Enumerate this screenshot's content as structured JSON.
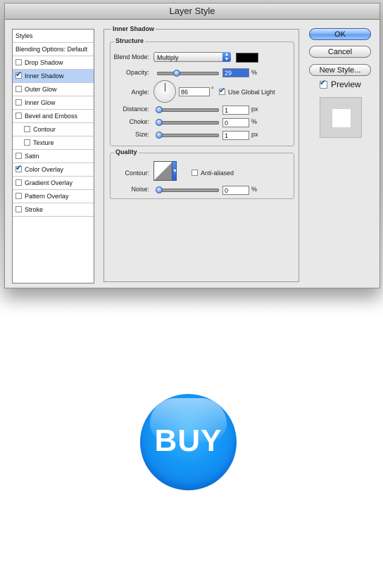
{
  "window": {
    "title": "Layer Style"
  },
  "styles_list": {
    "items": [
      {
        "label": "Styles",
        "checkbox": false
      },
      {
        "label": "Blending Options: Default",
        "checkbox": false
      },
      {
        "label": "Drop Shadow",
        "checkbox": true,
        "checked": false
      },
      {
        "label": "Inner Shadow",
        "checkbox": true,
        "checked": true,
        "selected": true
      },
      {
        "label": "Outer Glow",
        "checkbox": true,
        "checked": false
      },
      {
        "label": "Inner Glow",
        "checkbox": true,
        "checked": false
      },
      {
        "label": "Bevel and Emboss",
        "checkbox": true,
        "checked": false
      },
      {
        "label": "Contour",
        "checkbox": true,
        "checked": false
      },
      {
        "label": "Texture",
        "checkbox": true,
        "checked": false
      },
      {
        "label": "Satin",
        "checkbox": true,
        "checked": false
      },
      {
        "label": "Color Overlay",
        "checkbox": true,
        "checked": true
      },
      {
        "label": "Gradient Overlay",
        "checkbox": true,
        "checked": false
      },
      {
        "label": "Pattern Overlay",
        "checkbox": true,
        "checked": false
      },
      {
        "label": "Stroke",
        "checkbox": true,
        "checked": false
      }
    ]
  },
  "panel": {
    "title": "Inner Shadow",
    "structure": {
      "title": "Structure",
      "blend_mode_label": "Blend Mode:",
      "blend_mode_value": "Multiply",
      "blend_color": "#000000",
      "opacity_label": "Opacity:",
      "opacity_value": "29",
      "opacity_unit": "%",
      "angle_label": "Angle:",
      "angle_value": "86",
      "angle_unit": "°",
      "use_global_light_label": "Use Global Light",
      "use_global_light_checked": true,
      "distance_label": "Distance:",
      "distance_value": "1",
      "distance_unit": "px",
      "choke_label": "Choke:",
      "choke_value": "0",
      "choke_unit": "%",
      "size_label": "Size:",
      "size_value": "1",
      "size_unit": "px"
    },
    "quality": {
      "title": "Quality",
      "contour_label": "Contour:",
      "anti_aliased_label": "Anti-aliased",
      "anti_aliased_checked": false,
      "noise_label": "Noise:",
      "noise_value": "0",
      "noise_unit": "%"
    }
  },
  "buttons": {
    "ok": "OK",
    "cancel": "Cancel",
    "new_style": "New Style...",
    "preview_label": "Preview",
    "preview_checked": true
  },
  "buy_button": {
    "label": "BUY",
    "color": "#1596f5"
  }
}
